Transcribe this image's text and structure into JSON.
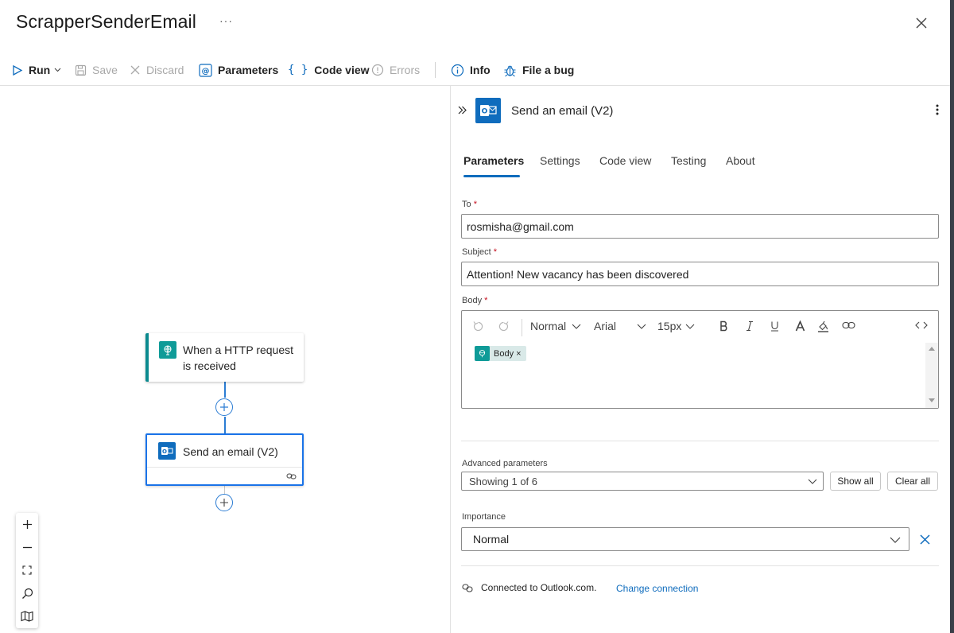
{
  "header": {
    "title": "ScrapperSenderEmail",
    "more": "···"
  },
  "toolbar": {
    "run": "Run",
    "save": "Save",
    "discard": "Discard",
    "parameters": "Parameters",
    "code_view": "Code view",
    "errors": "Errors",
    "info": "Info",
    "file_bug": "File a bug"
  },
  "canvas": {
    "nodes": [
      {
        "label": "When a HTTP request is received",
        "icon": "http-request-icon"
      },
      {
        "label": "Send an email (V2)",
        "icon": "outlook-icon"
      }
    ]
  },
  "panel": {
    "title": "Send an email (V2)",
    "tabs": [
      "Parameters",
      "Settings",
      "Code view",
      "Testing",
      "About"
    ],
    "active_tab": "Parameters",
    "to": {
      "label": "To",
      "required": "*",
      "value": "rosmisha@gmail.com"
    },
    "subject": {
      "label": "Subject",
      "required": "*",
      "value": "Attention! New vacancy has been discovered"
    },
    "body": {
      "label": "Body",
      "required": "*",
      "format": "Normal",
      "font": "Arial",
      "size": "15px",
      "token": "Body",
      "token_remove": "×"
    },
    "advanced": {
      "label": "Advanced parameters",
      "value": "Showing 1 of 6",
      "show_all": "Show all",
      "clear_all": "Clear all"
    },
    "importance": {
      "label": "Importance",
      "value": "Normal"
    },
    "connection": {
      "text": "Connected to Outlook.com.",
      "change": "Change connection"
    }
  },
  "colors": {
    "accent": "#0f6cbd",
    "trigger": "#0f9b98",
    "required": "#c50f1f"
  }
}
